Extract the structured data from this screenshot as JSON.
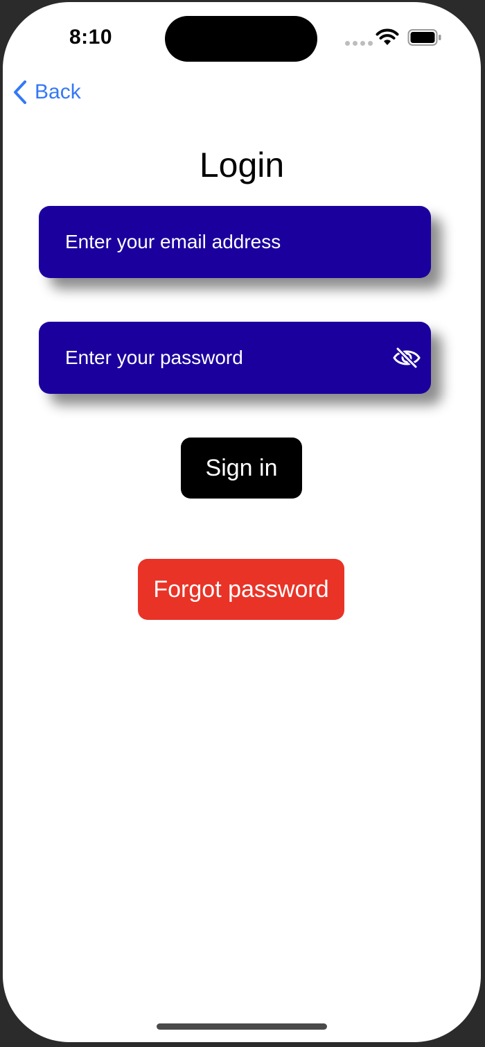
{
  "status_bar": {
    "time": "8:10"
  },
  "nav": {
    "back_label": "Back"
  },
  "page": {
    "title": "Login"
  },
  "form": {
    "email_placeholder": "Enter your email address",
    "email_value": "",
    "password_placeholder": "Enter your password",
    "password_value": "",
    "sign_in_label": "Sign in",
    "forgot_label": "Forgot password"
  },
  "icons": {
    "back": "chevron-left-icon",
    "password_visibility": "eye-slash-icon",
    "wifi": "wifi-icon",
    "battery": "battery-icon"
  },
  "colors": {
    "accent": "#3478f6",
    "field_background": "#1b009e",
    "sign_in_background": "#000000",
    "forgot_background": "#e93327"
  }
}
